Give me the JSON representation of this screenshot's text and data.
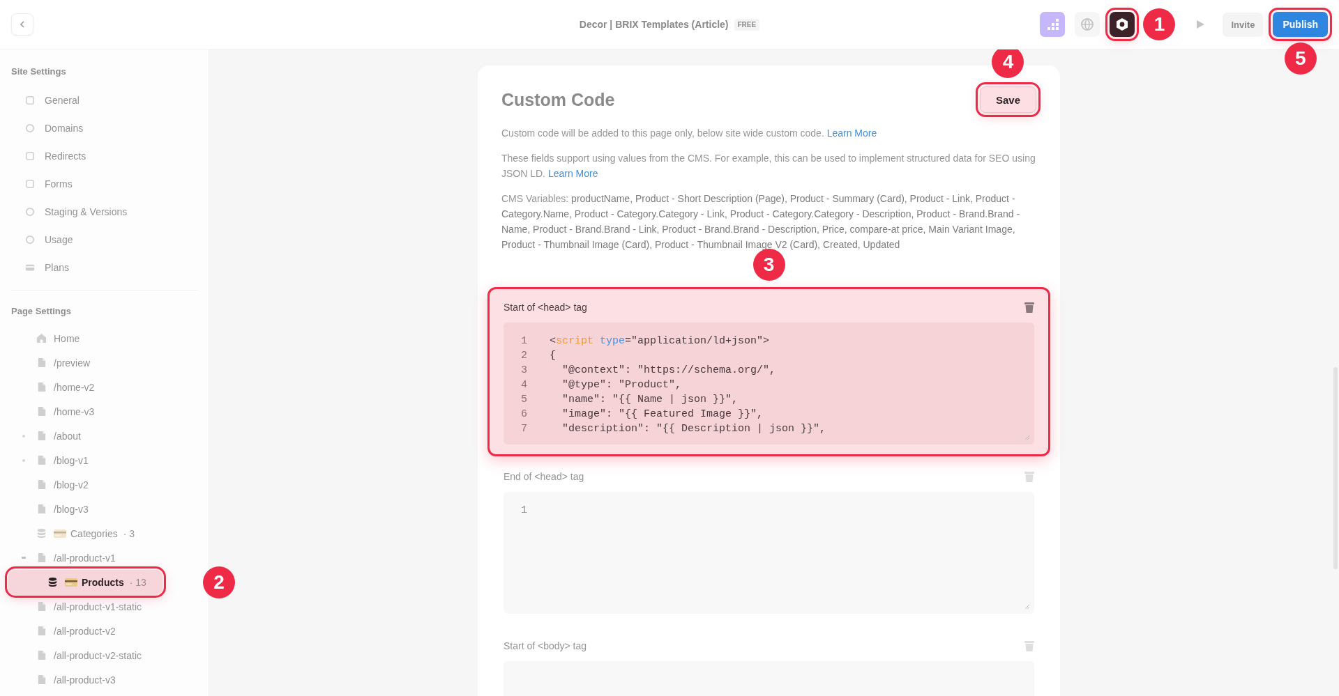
{
  "topbar": {
    "title": "Decor | BRIX Templates (Article)",
    "badge": "FREE",
    "tools": [
      {
        "kind": "analytics"
      },
      {
        "kind": "globe"
      },
      {
        "kind": "settings",
        "highlighted": true,
        "marker": "1"
      },
      {
        "kind": "play"
      }
    ],
    "invite": {
      "label": "Invite"
    },
    "publish": {
      "label": "Publish",
      "highlighted": true,
      "marker": "5"
    }
  },
  "sidebar": {
    "site_settings": {
      "heading": "Site Settings",
      "items": [
        {
          "label": "General",
          "kind": "square"
        },
        {
          "label": "Domains",
          "kind": "circle"
        },
        {
          "label": "Redirects",
          "kind": "square"
        },
        {
          "label": "Forms",
          "kind": "square"
        },
        {
          "label": "Staging & Versions",
          "kind": "circle"
        },
        {
          "label": "Usage",
          "kind": "circle"
        },
        {
          "label": "Plans",
          "kind": "card"
        }
      ]
    },
    "page_settings": {
      "heading": "Page Settings",
      "items": [
        {
          "label": "Home",
          "kind": "home",
          "highlighted": false
        },
        {
          "label": "/preview",
          "kind": "page",
          "highlighted": false
        },
        {
          "label": "/home-v2",
          "kind": "page",
          "highlighted": false
        },
        {
          "label": "/home-v3",
          "kind": "page",
          "highlighted": false
        },
        {
          "label": "/about",
          "kind": "page",
          "expanded": false,
          "highlighted": false
        },
        {
          "label": "/blog-v1",
          "kind": "page",
          "expanded": false,
          "highlighted": false
        },
        {
          "label": "/blog-v2",
          "kind": "page",
          "highlighted": false
        },
        {
          "label": "/blog-v3",
          "kind": "page",
          "highlighted": false
        },
        {
          "label": "Categories",
          "kind": "collection",
          "count": "· 3",
          "highlighted": false
        },
        {
          "label": "/all-product-v1",
          "kind": "page",
          "expanded": true,
          "highlighted": false,
          "children": [
            {
              "label": "Products",
              "kind": "collection",
              "count": "· 13",
              "highlighted": true,
              "marker": "2"
            }
          ]
        },
        {
          "label": "/all-product-v1-static",
          "kind": "page",
          "highlighted": false
        },
        {
          "label": "/all-product-v2",
          "kind": "page",
          "highlighted": false
        },
        {
          "label": "/all-product-v2-static",
          "kind": "page",
          "highlighted": false
        },
        {
          "label": "/all-product-v3",
          "kind": "page",
          "highlighted": false
        }
      ]
    }
  },
  "card": {
    "title": "Custom Code",
    "save": {
      "label": "Save",
      "highlighted": true,
      "marker": "4"
    },
    "intro": {
      "text": "Custom code will be added to this page only, below site wide custom code.",
      "link": "Learn More"
    },
    "cms_note": {
      "text": "These fields support using values from the CMS. For example, this can be used to implement structured data for SEO using JSON LD.",
      "link": "Learn More"
    },
    "cms_variables": {
      "label": "CMS Variables:",
      "value": "productName, Product - Short Description (Page), Product - Summary (Card), Product - Link, Product - Category.Name, Product - Category.Category - Link, Product - Category.Category - Description, Product - Brand.Brand - Name, Product - Brand.Brand - Link, Product - Brand.Brand - Description, Price, compare-at price, Main Variant Image, Product - Thumbnail Image (Card), Product - Thumbnail Image V2 (Card), Created, Updated"
    },
    "sections": [
      {
        "label": "Start of <head> tag",
        "highlighted": true,
        "marker": "3",
        "lines": [
          {
            "number": "1",
            "segments": [
              {
                "text": "<",
                "kind": "plain"
              },
              {
                "text": "script",
                "kind": "tag"
              },
              {
                "text": " type",
                "kind": "attr"
              },
              {
                "text": "=\"application/ld+json\">",
                "kind": "plain"
              }
            ]
          },
          {
            "number": "2",
            "segments": [
              {
                "text": "{",
                "kind": "plain"
              }
            ]
          },
          {
            "number": "3",
            "segments": [
              {
                "text": "  \"@context\": \"https://schema.org/\",",
                "kind": "plain"
              }
            ]
          },
          {
            "number": "4",
            "segments": [
              {
                "text": "  \"@type\": \"Product\",",
                "kind": "plain"
              }
            ]
          },
          {
            "number": "5",
            "segments": [
              {
                "text": "  \"name\": \"{{ Name | json }}\",",
                "kind": "plain"
              }
            ]
          },
          {
            "number": "6",
            "segments": [
              {
                "text": "  \"image\": \"{{ Featured Image }}\",",
                "kind": "plain"
              }
            ]
          },
          {
            "number": "7",
            "segments": [
              {
                "text": "  \"description\": \"{{ Description | json }}\",",
                "kind": "plain"
              }
            ]
          }
        ]
      },
      {
        "label": "End of <head> tag",
        "highlighted": false,
        "lines": [
          {
            "number": "1"
          }
        ]
      },
      {
        "label": "Start of <body> tag",
        "highlighted": false
      }
    ]
  }
}
